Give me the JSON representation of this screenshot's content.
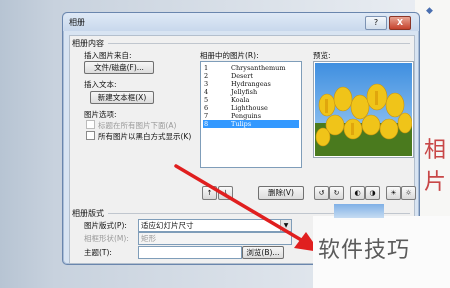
{
  "dialog": {
    "title": "相册",
    "help_label": "?",
    "close_label": "X"
  },
  "album_content": {
    "group_title": "相册内容",
    "insert_from_label": "插入图片来自:",
    "file_disk_button": "文件/磁盘(F)...",
    "insert_text_label": "插入文本:",
    "new_textbox_button": "新建文本框(X)",
    "picture_options_label": "图片选项:",
    "option_captions": "标题在所有图片下面(A)",
    "option_black_white": "所有图片以黑白方式显示(K)"
  },
  "pictures_list": {
    "label": "相册中的图片(R):",
    "items": [
      {
        "num": "1",
        "name": "Chrysanthemum"
      },
      {
        "num": "2",
        "name": "Desert"
      },
      {
        "num": "3",
        "name": "Hydrangeas"
      },
      {
        "num": "4",
        "name": "Jellyfish"
      },
      {
        "num": "5",
        "name": "Koala"
      },
      {
        "num": "6",
        "name": "Lighthouse"
      },
      {
        "num": "7",
        "name": "Penguins"
      },
      {
        "num": "8",
        "name": "Tulips"
      }
    ],
    "selected_index": 7,
    "move_up_label": "↑",
    "move_down_label": "↓",
    "delete_button": "删除(V)"
  },
  "preview": {
    "label": "预览:"
  },
  "layout": {
    "group_title": "相册版式",
    "picture_layout_label": "图片版式(P):",
    "picture_layout_value": "适应幻灯片尺寸",
    "frame_shape_label": "相框形状(M):",
    "frame_shape_value": "矩形",
    "theme_label": "主题(T):",
    "theme_value": "",
    "browse_button": "浏览(B)..."
  },
  "background": {
    "side_text": "相片",
    "watermark": "软件技巧"
  },
  "colors": {
    "selection": "#3399ff",
    "arrow": "#e01f1f",
    "dialog_frame": "#d8e4f2"
  }
}
